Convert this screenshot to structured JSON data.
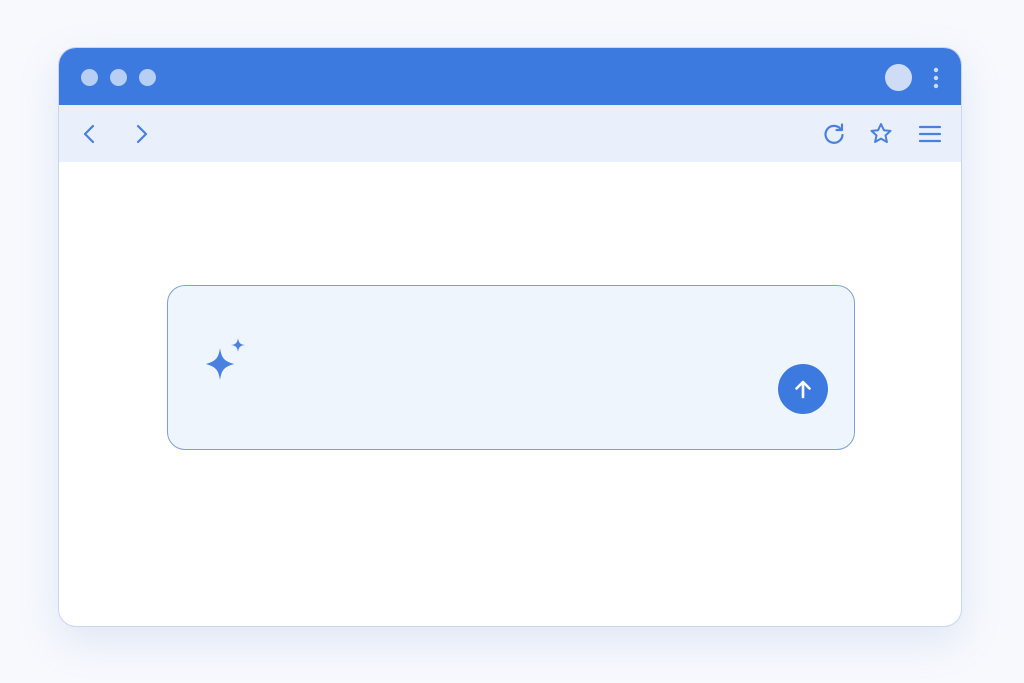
{
  "window": {
    "accent_color": "#3d7ae0",
    "titlebar": {
      "window_controls": [
        "window-dot",
        "window-dot",
        "window-dot"
      ],
      "profile": "profile-avatar",
      "menu": "more-vertical-icon"
    },
    "toolbar": {
      "back_icon": "chevron-left-icon",
      "forward_icon": "chevron-right-icon",
      "reload_icon": "reload-icon",
      "bookmark_icon": "star-icon",
      "menu_icon": "hamburger-menu-icon"
    }
  },
  "prompt": {
    "icon": "sparkle-icon",
    "value": "",
    "placeholder": "",
    "send_icon": "arrow-up-icon",
    "box_background": "#eff5fd",
    "box_border": "#7aa0dd"
  }
}
